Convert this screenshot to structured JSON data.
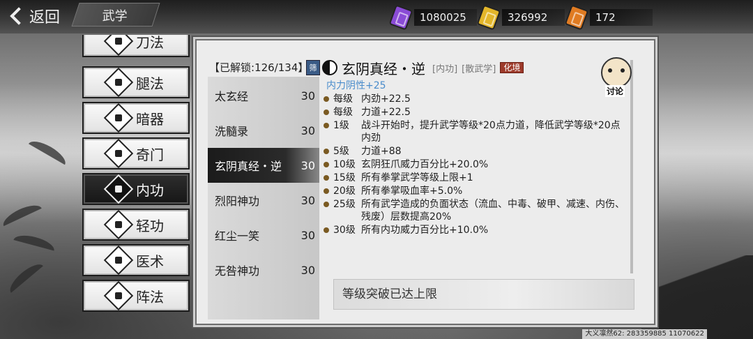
{
  "topbar": {
    "back_label": "返回",
    "section_title": "武学",
    "currencies": [
      {
        "icon": "purple-ticket-icon",
        "color": "#8a4bd6",
        "value": "1080025"
      },
      {
        "icon": "gold-ticket-icon",
        "color": "#e3b62a",
        "value": "326992"
      },
      {
        "icon": "orange-ticket-icon",
        "color": "#e07b22",
        "value": "172"
      }
    ]
  },
  "categories": [
    {
      "label": "刀法",
      "icon": "blade-icon",
      "active": false
    },
    {
      "label": "腿法",
      "icon": "leg-icon",
      "active": false
    },
    {
      "label": "暗器",
      "icon": "dart-icon",
      "active": false
    },
    {
      "label": "奇门",
      "icon": "odd-weapon-icon",
      "active": false
    },
    {
      "label": "内功",
      "icon": "inner-power-icon",
      "active": true
    },
    {
      "label": "轻功",
      "icon": "lightness-icon",
      "active": false
    },
    {
      "label": "医术",
      "icon": "medicine-icon",
      "active": false
    },
    {
      "label": "阵法",
      "icon": "formation-icon",
      "active": false
    }
  ],
  "panel": {
    "unlock_text": "【已解锁:126/134】",
    "filter_label": "筛",
    "skills": [
      {
        "name": "太玄经",
        "level": "30",
        "selected": false
      },
      {
        "name": "洗髓录",
        "level": "30",
        "selected": false
      },
      {
        "name": "玄阴真经・逆",
        "level": "30",
        "selected": true
      },
      {
        "name": "烈阳神功",
        "level": "30",
        "selected": false
      },
      {
        "name": "红尘一笑",
        "level": "30",
        "selected": false
      },
      {
        "name": "无咎神功",
        "level": "30",
        "selected": false
      },
      {
        "name": "",
        "level": "",
        "selected": false
      }
    ]
  },
  "detail": {
    "name": "玄阴真经・逆",
    "tag_type": "[内功]",
    "tag_school": "[散武学]",
    "tag_realm": "化境",
    "inner_attr": "内力阴性+25",
    "discuss_label": "讨论",
    "effects": [
      {
        "level": "每级",
        "text": "内劲+22.5"
      },
      {
        "level": "每级",
        "text": "力道+22.5"
      },
      {
        "level": "1级",
        "text": "战斗开始时，提升武学等级*20点力道，降低武学等级*20点内劲"
      },
      {
        "level": "5级",
        "text": "力道+88"
      },
      {
        "level": "10级",
        "text": "玄阴狂爪威力百分比+20.0%"
      },
      {
        "level": "15级",
        "text": "所有拳掌武学等级上限+1"
      },
      {
        "level": "20级",
        "text": "所有拳掌吸血率+5.0%"
      },
      {
        "level": "25级",
        "text": "所有武学造成的负面状态（流血、中毒、破甲、减速、内伤、残废）层数提高20%"
      },
      {
        "level": "30级",
        "text": "所有内功威力百分比+10.0%"
      }
    ],
    "limit_text": "等级突破已达上限"
  },
  "footer": {
    "id_text": "大义凛然62: 283359885 11070622"
  }
}
